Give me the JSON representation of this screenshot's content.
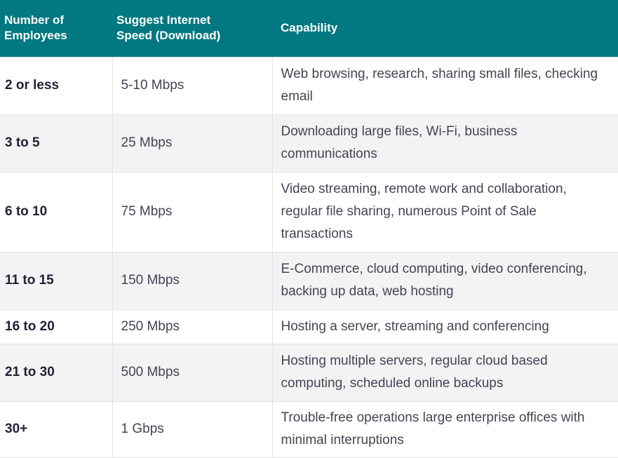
{
  "header": {
    "col1": "Number of Employees",
    "col1_line1": "Number of",
    "col1_line2": "Employees",
    "col2_line1": "Suggest Internet",
    "col2_line2": "Speed (Download)",
    "col3": "Capability"
  },
  "colors": {
    "header_bg": "#027880",
    "header_text": "#ffffff",
    "row_alt_bg": "#f3f3f3"
  },
  "rows": [
    {
      "employees": "2 or less",
      "speed": "5-10 Mbps",
      "capability": "Web browsing, research, sharing small files, checking email"
    },
    {
      "employees": "3 to 5",
      "speed": "25 Mbps",
      "capability": "Downloading large files, Wi-Fi, business communications"
    },
    {
      "employees": "6 to 10",
      "speed": "75 Mbps",
      "capability": "Video streaming, remote work and collaboration, regular file sharing, numerous Point of Sale transactions"
    },
    {
      "employees": "11 to 15",
      "speed": "150 Mbps",
      "capability": "E-Commerce, cloud computing, video conferencing, backing up data, web hosting"
    },
    {
      "employees": "16 to 20",
      "speed": "250 Mbps",
      "capability": "Hosting a server, streaming and conferencing"
    },
    {
      "employees": "21 to 30",
      "speed": "500 Mbps",
      "capability": "Hosting multiple servers, regular cloud based computing, scheduled online backups"
    },
    {
      "employees": "30+",
      "speed": "1 Gbps",
      "capability": "Trouble-free operations large enterprise offices with minimal interruptions"
    }
  ]
}
